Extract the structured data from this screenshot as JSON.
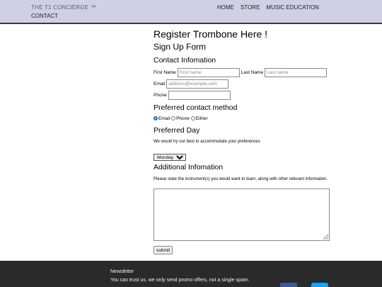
{
  "nav": {
    "brand": "THE T1 CONCIERGE ™",
    "contact": "CONTACT",
    "links": [
      "HOME",
      "STORE",
      "MUSIC EDUCATION"
    ]
  },
  "form": {
    "title": "Register Trombone Here !",
    "subtitle": "Sign Up Form",
    "contact_heading": "Contact Infomation",
    "first_name_label": "First Name",
    "first_name_placeholder": "First name",
    "last_name_label": "Last Name",
    "last_name_placeholder": "Last name",
    "email_label": "Email",
    "email_placeholder": "address@example.com",
    "phone_label": "Phone",
    "method_heading": "Preferred contact method",
    "methods": [
      "Email",
      "Phone",
      "Either"
    ],
    "selected_method": "Email",
    "day_heading": "Preferred Day",
    "day_hint": "We would try our best to accommodate your preferences",
    "day_selected": "Monday",
    "additional_heading": "Additional Infomation",
    "additional_hint": "Please state the instrument(s) you would want to learn, along with other relevant information.",
    "submit_label": "submit"
  },
  "footer": {
    "newsletter_title": "Newsletter",
    "newsletter_text": "You can trust us. we only send promo offers, not a single spam."
  },
  "icons": {
    "facebook": "facebook-icon",
    "twitter": "twitter-icon"
  },
  "colors": {
    "nav_bg": "#cfd0e6",
    "footer_bg": "#2a2a2a",
    "radio_selected": "#1a6ce0"
  }
}
